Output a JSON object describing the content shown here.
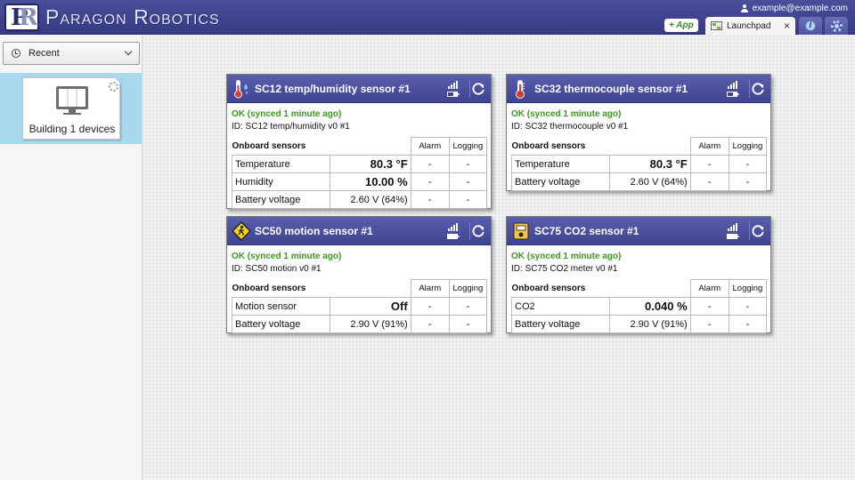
{
  "header": {
    "brand": "Paragon Robotics",
    "user_email": "example@example.com",
    "app_button": "+ App",
    "tab_label": "Launchpad",
    "tab_close": "×",
    "info_glyph": "i"
  },
  "sidebar": {
    "recent_label": "Recent",
    "tile_label": "Building 1 devices"
  },
  "cards": [
    {
      "title": "SC12 temp/humidity sensor #1",
      "status": "OK (synced 1 minute ago)",
      "id": "ID: SC12 temp/humidity v0 #1",
      "section": "Onboard sensors",
      "col_alarm": "Alarm",
      "col_logging": "Logging",
      "icon": "thermometer-humidity-icon",
      "rows": [
        {
          "name": "Temperature",
          "value": "80.3 °F",
          "alarm": "-",
          "logging": "-"
        },
        {
          "name": "Humidity",
          "value": "10.00 %",
          "alarm": "-",
          "logging": "-"
        },
        {
          "name": "Battery voltage",
          "value": "2.60 V (64%)",
          "alarm": "-",
          "logging": "-"
        }
      ]
    },
    {
      "title": "SC32 thermocouple sensor #1",
      "status": "OK (synced 1 minute ago)",
      "id": "ID: SC32 thermocouple v0 #1",
      "section": "Onboard sensors",
      "col_alarm": "Alarm",
      "col_logging": "Logging",
      "icon": "thermometer-icon",
      "rows": [
        {
          "name": "Temperature",
          "value": "80.3 °F",
          "alarm": "-",
          "logging": "-"
        },
        {
          "name": "Battery voltage",
          "value": "2.60 V (64%)",
          "alarm": "-",
          "logging": "-"
        }
      ]
    },
    {
      "title": "SC50 motion sensor #1",
      "status": "OK (synced 1 minute ago)",
      "id": "ID: SC50 motion v0 #1",
      "section": "Onboard sensors",
      "col_alarm": "Alarm",
      "col_logging": "Logging",
      "icon": "motion-warning-icon",
      "rows": [
        {
          "name": "Motion sensor",
          "value": "Off",
          "alarm": "-",
          "logging": "-"
        },
        {
          "name": "Battery voltage",
          "value": "2.90 V (91%)",
          "alarm": "-",
          "logging": "-"
        }
      ]
    },
    {
      "title": "SC75 CO2 sensor #1",
      "status": "OK (synced 1 minute ago)",
      "id": "ID: SC75 CO2 meter v0 #1",
      "section": "Onboard sensors",
      "col_alarm": "Alarm",
      "col_logging": "Logging",
      "icon": "co2-meter-icon",
      "rows": [
        {
          "name": "CO2",
          "value": "0.040 %",
          "alarm": "-",
          "logging": "-"
        },
        {
          "name": "Battery voltage",
          "value": "2.90 V (91%)",
          "alarm": "-",
          "logging": "-"
        }
      ]
    }
  ],
  "colors": {
    "header": "#3e4392",
    "status_ok": "#3a9a1f",
    "tile_highlight": "#a9d9ee"
  }
}
